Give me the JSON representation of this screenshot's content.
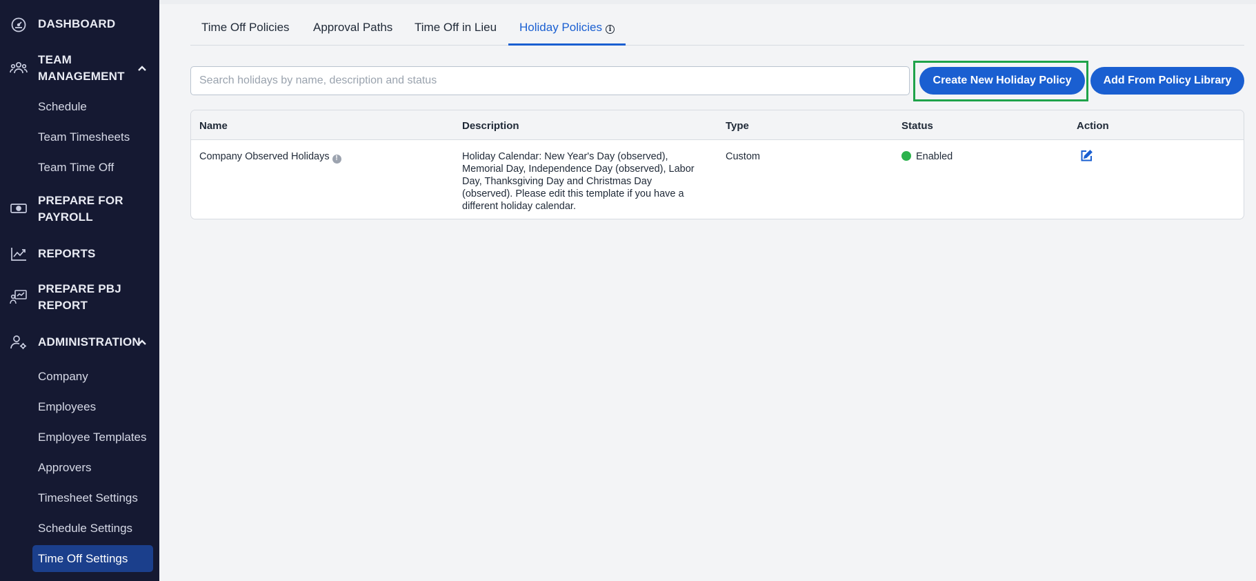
{
  "sidebar": {
    "dashboard": "DASHBOARD",
    "team_management": {
      "line1": "TEAM",
      "line2": "MANAGEMENT"
    },
    "team_items": [
      "Schedule",
      "Team Timesheets",
      "Team Time Off"
    ],
    "prepare_payroll": {
      "line1": "PREPARE FOR",
      "line2": "PAYROLL"
    },
    "reports": "REPORTS",
    "prepare_pbj": {
      "line1": "PREPARE PBJ",
      "line2": "REPORT"
    },
    "administration": "ADMINISTRATION",
    "admin_items": [
      "Company",
      "Employees",
      "Employee Templates",
      "Approvers",
      "Timesheet Settings",
      "Schedule Settings",
      "Time Off Settings"
    ],
    "active_item": "Time Off Settings"
  },
  "tabs": [
    "Time Off Policies",
    "Approval Paths",
    "Time Off in Lieu",
    "Holiday Policies"
  ],
  "active_tab": "Holiday Policies",
  "search": {
    "placeholder": "Search holidays by name, description and status",
    "value": ""
  },
  "buttons": {
    "create": "Create New Holiday Policy",
    "library": "Add From Policy Library"
  },
  "table": {
    "headers": [
      "Name",
      "Description",
      "Type",
      "Status",
      "Action"
    ],
    "rows": [
      {
        "name": "Company Observed Holidays",
        "description": "Holiday Calendar: New Year's Day (observed), Memorial Day, Independence Day (observed), Labor Day, Thanksgiving Day and Christmas Day (observed). Please edit this template if you have a different holiday calendar.",
        "type": "Custom",
        "status": "Enabled",
        "status_color": "#2bb24c"
      }
    ]
  },
  "colors": {
    "sidebar_bg": "#151932",
    "accent": "#1a5fd1",
    "active_item_bg": "#1b3f8c",
    "highlight": "#1fa34a"
  }
}
